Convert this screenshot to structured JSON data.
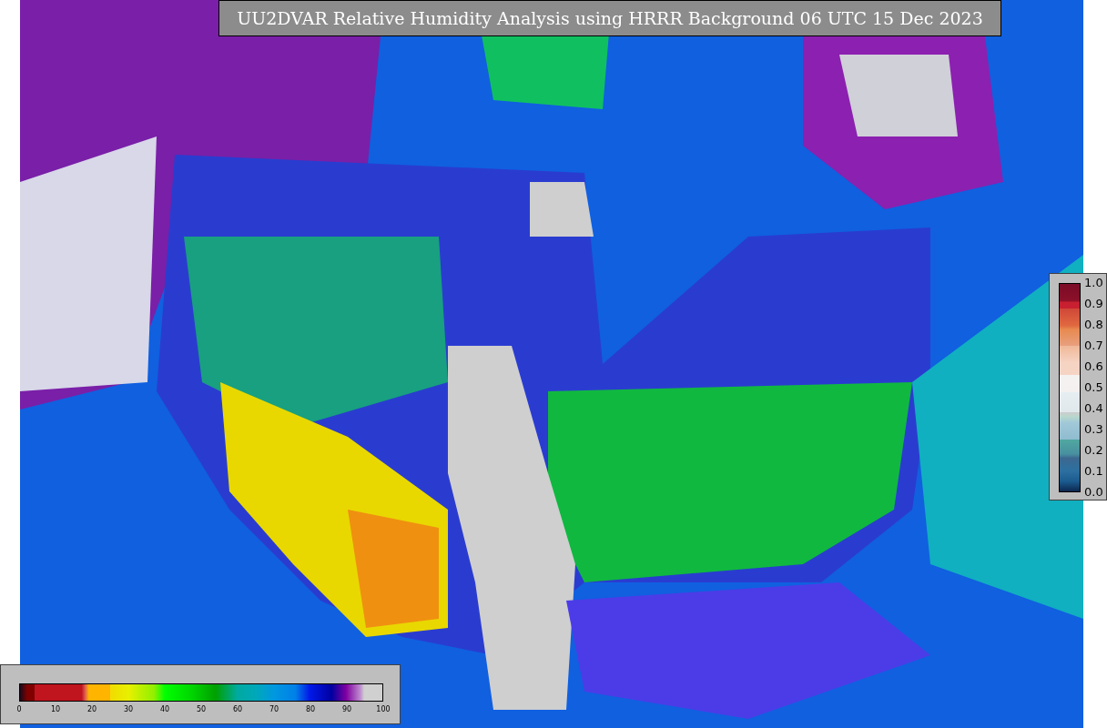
{
  "title": "UU2DVAR Relative Humidity Analysis using HRRR Background 06 UTC 15 Dec 2023",
  "humidity_colorbar": {
    "ticks": [
      "0",
      "10",
      "20",
      "30",
      "40",
      "50",
      "60",
      "70",
      "80",
      "90",
      "100"
    ]
  },
  "ratio_colorbar": {
    "ticks": [
      "1.0",
      "0.9",
      "0.8",
      "0.7",
      "0.6",
      "0.5",
      "0.4",
      "0.3",
      "0.2",
      "0.1",
      "0.0"
    ]
  }
}
